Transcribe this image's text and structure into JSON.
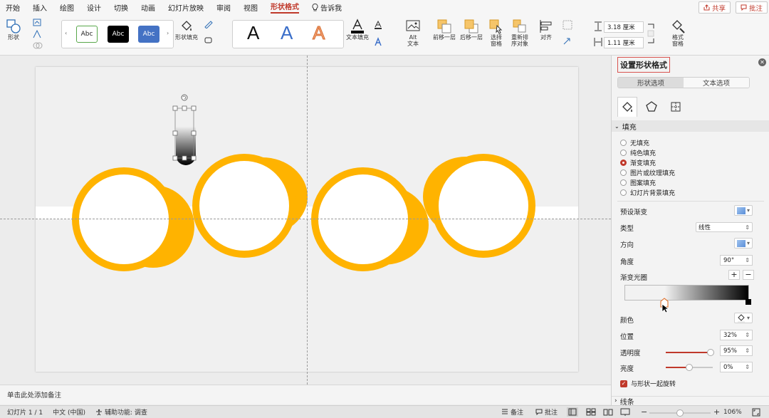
{
  "menu": {
    "items": [
      "开始",
      "插入",
      "绘图",
      "设计",
      "切换",
      "动画",
      "幻灯片放映",
      "审阅",
      "视图"
    ],
    "active": "形状格式",
    "tell_me": "告诉我",
    "share": "共享",
    "comments": "批注"
  },
  "ribbon": {
    "shape_label": "形状",
    "style_labels": [
      "Abc",
      "Abc",
      "Abc"
    ],
    "shape_fill": "形状填充",
    "text_fill": "文本填充",
    "wordart": [
      "A",
      "A",
      "A"
    ],
    "alt_text": "Alt\n文本",
    "bring_forward": "前移一层",
    "send_backward": "后移一层",
    "selection_pane": "选择\n窗格",
    "reorder": "重新排\n序对象",
    "align": "对齐",
    "height": "3.18 厘米",
    "width": "1.11 厘米",
    "format_pane": "格式\n窗格"
  },
  "notes_placeholder": "单击此处添加备注",
  "status": {
    "slide": "幻灯片 1 / 1",
    "language": "中文 (中国)",
    "accessibility": "辅助功能: 调查",
    "notes": "备注",
    "comments": "批注",
    "zoom": "106%"
  },
  "panel": {
    "title": "设置形状格式",
    "tab_shape": "形状选项",
    "tab_text": "文本选项",
    "fill_header": "填充",
    "fill_options": [
      "无填充",
      "纯色填充",
      "渐变填充",
      "图片或纹理填充",
      "图案填充",
      "幻灯片背景填充"
    ],
    "fill_selected": 2,
    "preset": "预设渐变",
    "type_label": "类型",
    "type_value": "线性",
    "direction": "方向",
    "angle_label": "角度",
    "angle_value": "90°",
    "stops_label": "渐变光圈",
    "color_label": "颜色",
    "position_label": "位置",
    "position_value": "32%",
    "transparency_label": "透明度",
    "transparency_value": "95%",
    "transparency_level": 0.95,
    "brightness_label": "亮度",
    "brightness_value": "0%",
    "brightness_level": 0.5,
    "rotate_with_shape": "与形状一起旋转",
    "line_header": "线条"
  },
  "colors": {
    "accent": "#c0392b",
    "ring": "#FFB300"
  }
}
